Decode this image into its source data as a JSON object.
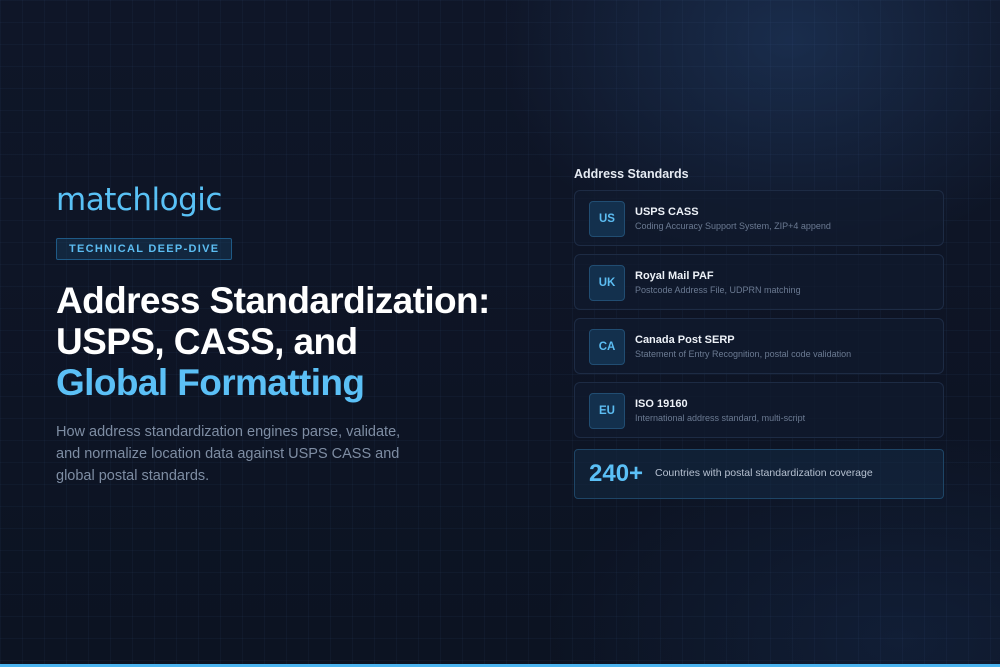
{
  "brand": {
    "logo_text": "matchlogic"
  },
  "hero": {
    "badge": "TECHNICAL DEEP-DIVE",
    "title_line1": "Address Standardization:",
    "title_line2": "USPS, CASS, and",
    "title_line3": "Global Formatting",
    "subtitle": "How address standardization engines parse, validate, and normalize location data against USPS CASS and global postal standards."
  },
  "standards": {
    "title": "Address Standards",
    "items": [
      {
        "code": "US",
        "name": "USPS CASS",
        "description": "Coding Accuracy Support System, ZIP+4 append"
      },
      {
        "code": "UK",
        "name": "Royal Mail PAF",
        "description": "Postcode Address File, UDPRN matching"
      },
      {
        "code": "CA",
        "name": "Canada Post SERP",
        "description": "Statement of Entry Recognition, postal code validation"
      },
      {
        "code": "EU",
        "name": "ISO 19160",
        "description": "International address standard, multi-script"
      }
    ],
    "stat": {
      "value": "240+",
      "label": "Countries with postal standardization coverage"
    }
  },
  "colors": {
    "background": "#0d1424",
    "accent": "#5bc0f6",
    "card_border": "#1d2b44",
    "muted_text": "#7e8da3"
  }
}
